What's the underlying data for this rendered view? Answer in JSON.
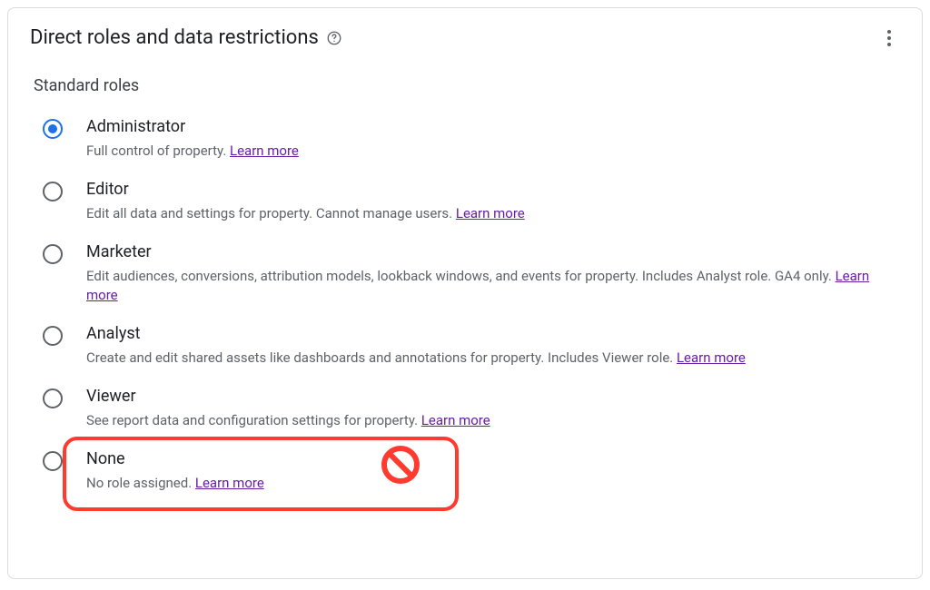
{
  "panel": {
    "title": "Direct roles and data restrictions"
  },
  "section": {
    "title": "Standard roles"
  },
  "roles": {
    "administrator": {
      "name": "Administrator",
      "desc": "Full control of property. ",
      "learn": "Learn more"
    },
    "editor": {
      "name": "Editor",
      "desc": "Edit all data and settings for property. Cannot manage users. ",
      "learn": "Learn more"
    },
    "marketer": {
      "name": "Marketer",
      "desc": "Edit audiences, conversions, attribution models, lookback windows, and events for property. Includes Analyst role. GA4 only. ",
      "learn": "Learn more"
    },
    "analyst": {
      "name": "Analyst",
      "desc": "Create and edit shared assets like dashboards and annotations for property. Includes Viewer role. ",
      "learn": "Learn more"
    },
    "viewer": {
      "name": "Viewer",
      "desc": "See report data and configuration settings for property. ",
      "learn": "Learn more"
    },
    "none": {
      "name": "None",
      "desc": "No role assigned. ",
      "learn": "Learn more"
    }
  }
}
